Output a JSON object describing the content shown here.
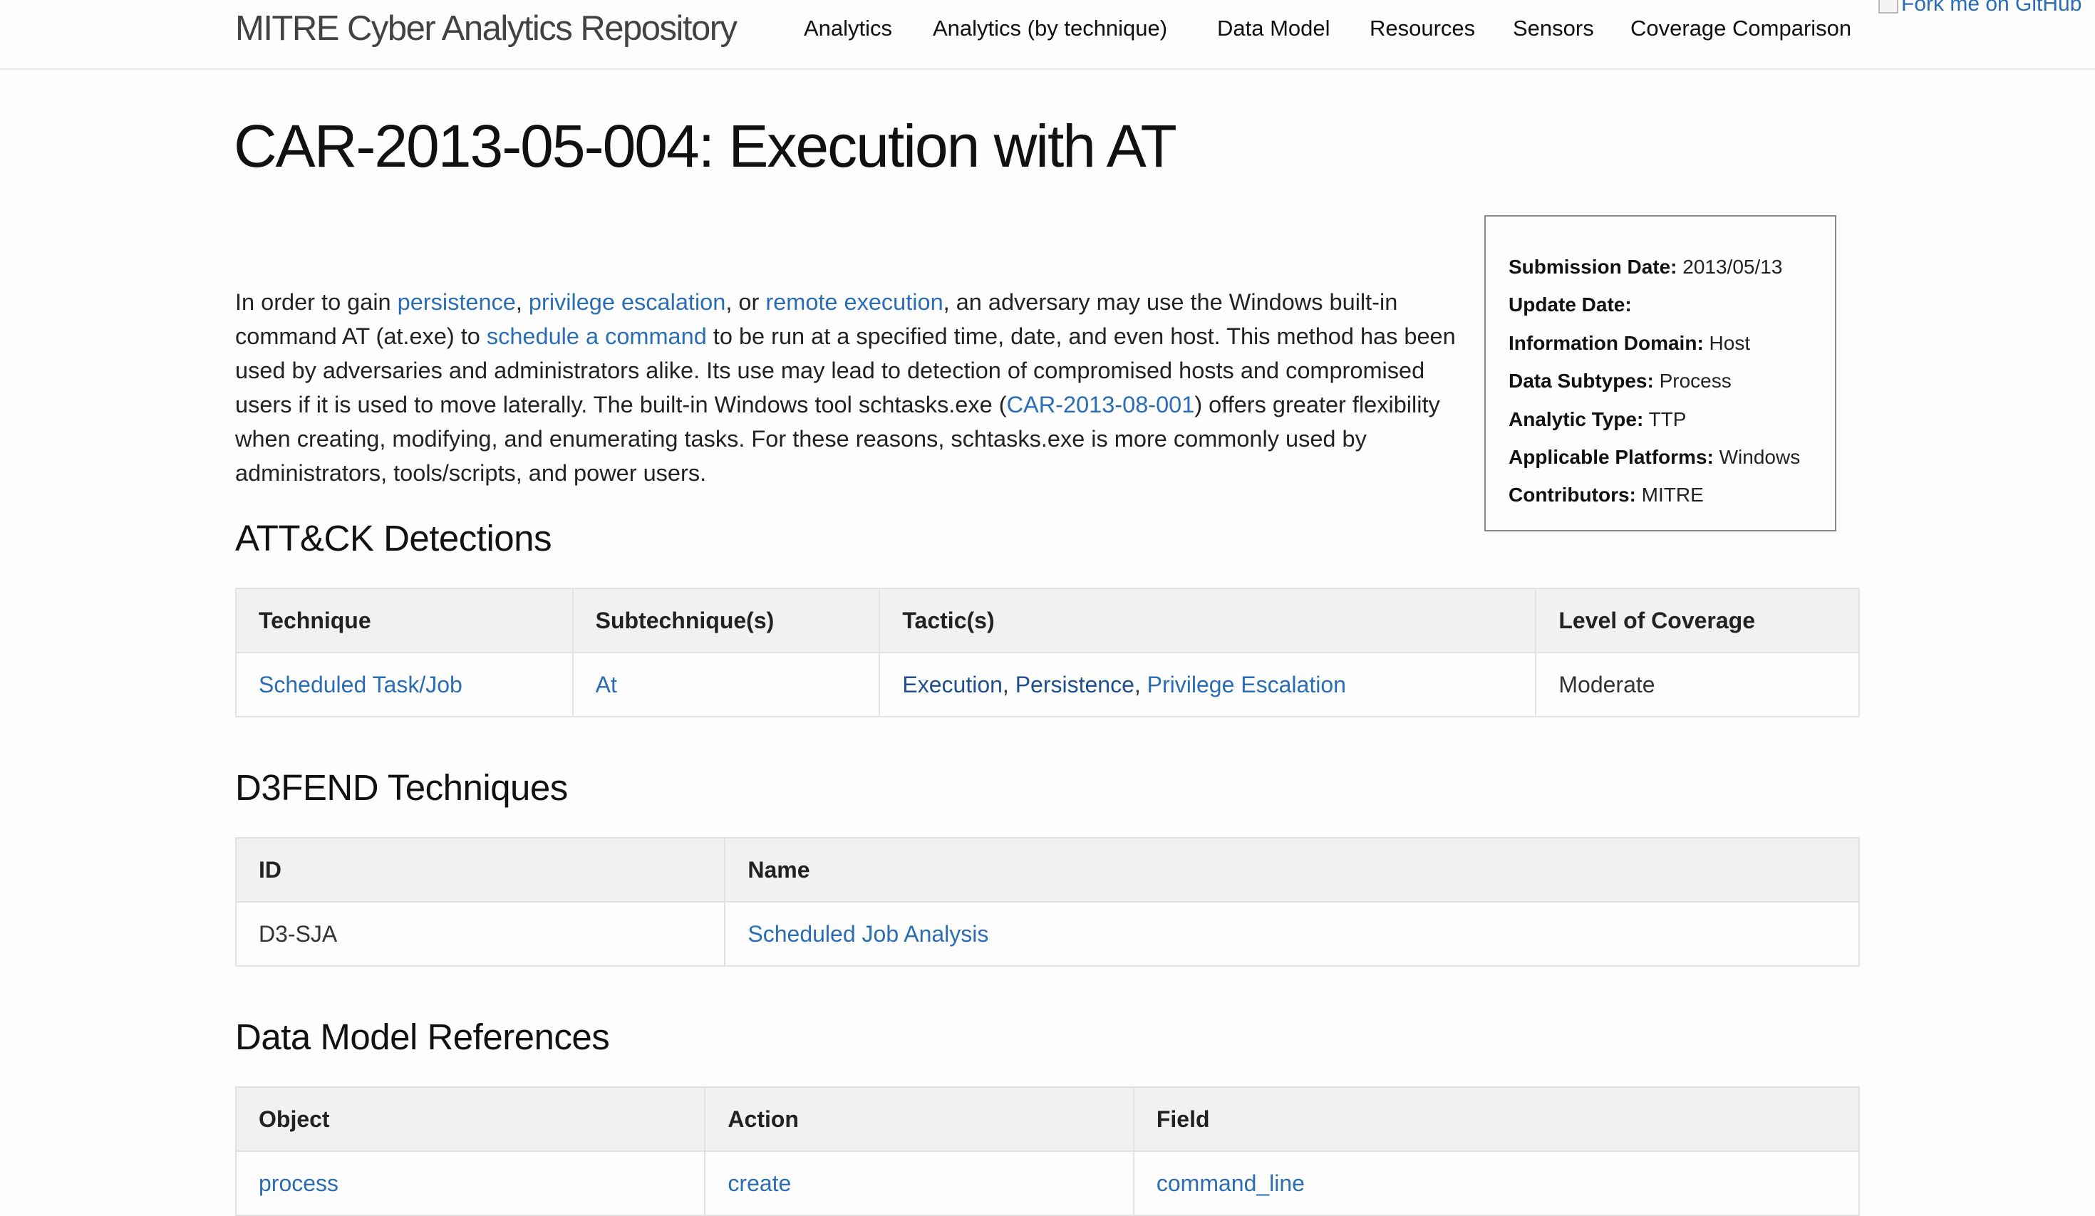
{
  "header": {
    "site_title": "MITRE Cyber Analytics Repository",
    "nav": [
      {
        "label": "Analytics"
      },
      {
        "label": "Analytics (by technique)"
      },
      {
        "label": "Data Model"
      },
      {
        "label": "Resources"
      },
      {
        "label": "Sensors"
      },
      {
        "label": "Coverage Comparison"
      }
    ],
    "fork_badge_alt": "Fork me on GitHub"
  },
  "page": {
    "title": "CAR-2013-05-004: Execution with AT"
  },
  "info": {
    "rows": [
      {
        "label": "Submission Date:",
        "value": "2013/05/13"
      },
      {
        "label": "Update Date:",
        "value": ""
      },
      {
        "label": "Information Domain:",
        "value": "Host"
      },
      {
        "label": "Data Subtypes:",
        "value": "Process"
      },
      {
        "label": "Analytic Type:",
        "value": "TTP"
      },
      {
        "label": "Applicable Platforms:",
        "value": "Windows"
      },
      {
        "label": "Contributors:",
        "value": "MITRE"
      }
    ]
  },
  "description": {
    "t1": "In order to gain ",
    "link_persistence": "persistence",
    "t2": ", ",
    "link_privesc": "privilege escalation",
    "t3": ", or ",
    "link_remote": "remote execution",
    "t4": ", an adversary may use the Windows built-in command AT (at.exe) to ",
    "link_schedule": "schedule a command",
    "t5": " to be run at a specified time, date, and even host. This method has been used by adversaries and administrators alike. Its use may lead to detection of compromised hosts and compromised users if it is used to move laterally. The built-in Windows tool schtasks.exe (",
    "link_car": "CAR-2013-08-001",
    "t6": ") offers greater flexibility when creating, modifying, and enumerating tasks. For these reasons, schtasks.exe is more commonly used by administrators, tools/scripts, and power users."
  },
  "attack": {
    "heading": "ATT&CK Detections",
    "headers": [
      "Technique",
      "Subtechnique(s)",
      "Tactic(s)",
      "Level of Coverage"
    ],
    "row": {
      "technique": "Scheduled Task/Job",
      "subtechnique": "At",
      "tactic1": "Execution",
      "tactic2": "Persistence",
      "tactic3": "Privilege Escalation",
      "sep": ", ",
      "coverage": "Moderate"
    }
  },
  "d3fend": {
    "heading": "D3FEND Techniques",
    "headers": [
      "ID",
      "Name"
    ],
    "row": {
      "id": "D3-SJA",
      "name": "Scheduled Job Analysis"
    }
  },
  "datamodel": {
    "heading": "Data Model References",
    "headers": [
      "Object",
      "Action",
      "Field"
    ],
    "row": {
      "object": "process",
      "action": "create",
      "field": "command_line"
    }
  }
}
